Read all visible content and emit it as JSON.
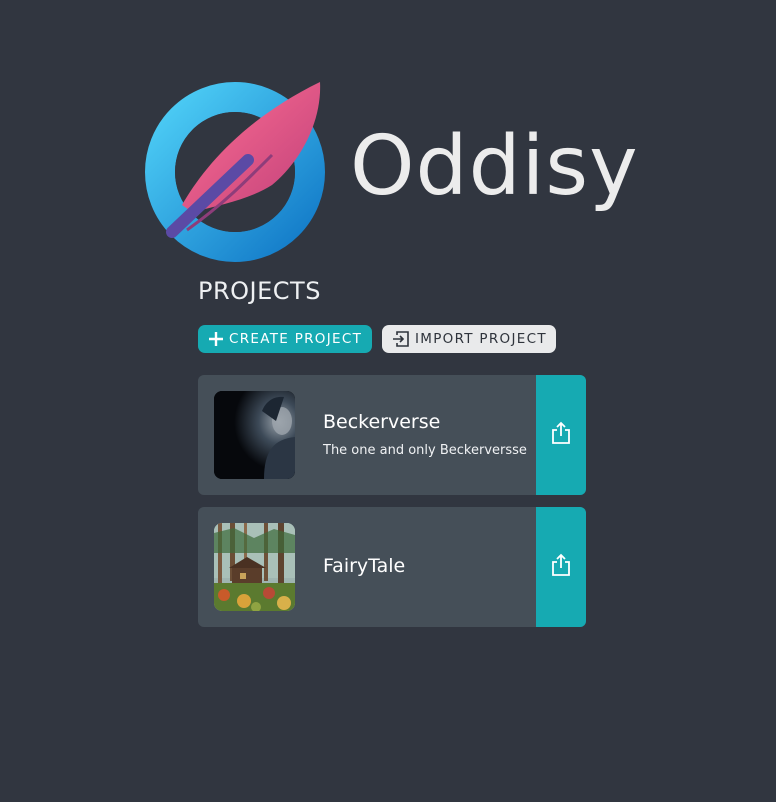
{
  "app": {
    "name": "Oddisy"
  },
  "colors": {
    "background": "#313640",
    "accent": "#16aab2",
    "card": "#454f58",
    "logo_ring": "#1ca3df",
    "logo_feather": "#e4557f"
  },
  "section_title": "PROJECTS",
  "toolbar": {
    "create_label": "CREATE PROJECT",
    "create_icon": "plus-icon",
    "import_label": "IMPORT PROJECT",
    "import_icon": "import-icon"
  },
  "projects": [
    {
      "title": "Beckerverse",
      "description": "The one and only Beckerversse",
      "thumbnail": "portrait-image",
      "action_icon": "share-icon"
    },
    {
      "title": "FairyTale",
      "description": "",
      "thumbnail": "forest-cabin-image",
      "action_icon": "share-icon"
    }
  ]
}
